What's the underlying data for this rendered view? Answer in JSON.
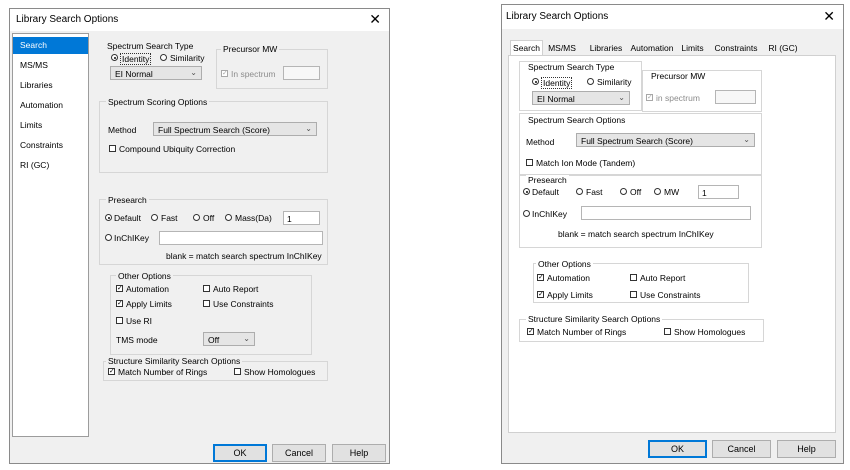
{
  "left": {
    "title": "Library Search Options",
    "nav": [
      "Search",
      "MS/MS",
      "Libraries",
      "Automation",
      "Limits",
      "Constraints",
      "RI (GC)"
    ],
    "spectrum_search_type": {
      "title": "Spectrum Search Type",
      "identity": "Identity",
      "similarity": "Similarity",
      "mode": "EI Normal"
    },
    "precursor": {
      "title": "Precursor MW",
      "in_spectrum": "In spectrum"
    },
    "scoring": {
      "title": "Spectrum Scoring Options",
      "method_label": "Method",
      "method_value": "Full Spectrum Search (Score)",
      "ubiquity": "Compound Ubiquity Correction"
    },
    "presearch": {
      "title": "Presearch",
      "default": "Default",
      "fast": "Fast",
      "off": "Off",
      "mass": "Mass(Da)",
      "mass_value": "1",
      "inchikey": "InChIKey",
      "blank_note": "blank = match search spectrum InChIKey"
    },
    "other": {
      "title": "Other Options",
      "automation": "Automation",
      "auto_report": "Auto Report",
      "apply_limits": "Apply Limits",
      "use_constraints": "Use Constraints",
      "use_ri": "Use RI",
      "tms_label": "TMS mode",
      "tms_value": "Off"
    },
    "structure": {
      "title": "Structure Similarity Search Options",
      "match_rings": "Match Number of Rings",
      "show_homologues": "Show Homologues"
    },
    "buttons": {
      "ok": "OK",
      "cancel": "Cancel",
      "help": "Help"
    }
  },
  "right": {
    "title": "Library Search Options",
    "tabs": [
      "Search",
      "MS/MS",
      "Libraries",
      "Automation",
      "Limits",
      "Constraints",
      "RI (GC)"
    ],
    "spectrum_search_type": {
      "title": "Spectrum Search Type",
      "identity": "Identity",
      "similarity": "Similarity",
      "mode": "EI Normal"
    },
    "precursor": {
      "title": "Precursor MW",
      "in_spectrum": "in spectrum"
    },
    "scoring": {
      "title": "Spectrum Search Options",
      "method_label": "Method",
      "method_value": "Full Spectrum Search (Score)",
      "ion_mode": "Match Ion Mode (Tandem)"
    },
    "presearch": {
      "title": "Presearch",
      "default": "Default",
      "fast": "Fast",
      "off": "Off",
      "mw": "MW",
      "mw_value": "1",
      "inchikey": "InChIKey",
      "blank_note": "blank = match search spectrum InChIKey"
    },
    "other": {
      "title": "Other Options",
      "automation": "Automation",
      "auto_report": "Auto Report",
      "apply_limits": "Apply Limits",
      "use_constraints": "Use Constraints"
    },
    "structure": {
      "title": "Structure Similarity Search Options",
      "match_rings": "Match Number of Rings",
      "show_homologues": "Show Homologues"
    },
    "buttons": {
      "ok": "OK",
      "cancel": "Cancel",
      "help": "Help"
    }
  },
  "colors": {
    "accent": "#0078d7",
    "dialog_bg": "#f0f0f0"
  }
}
